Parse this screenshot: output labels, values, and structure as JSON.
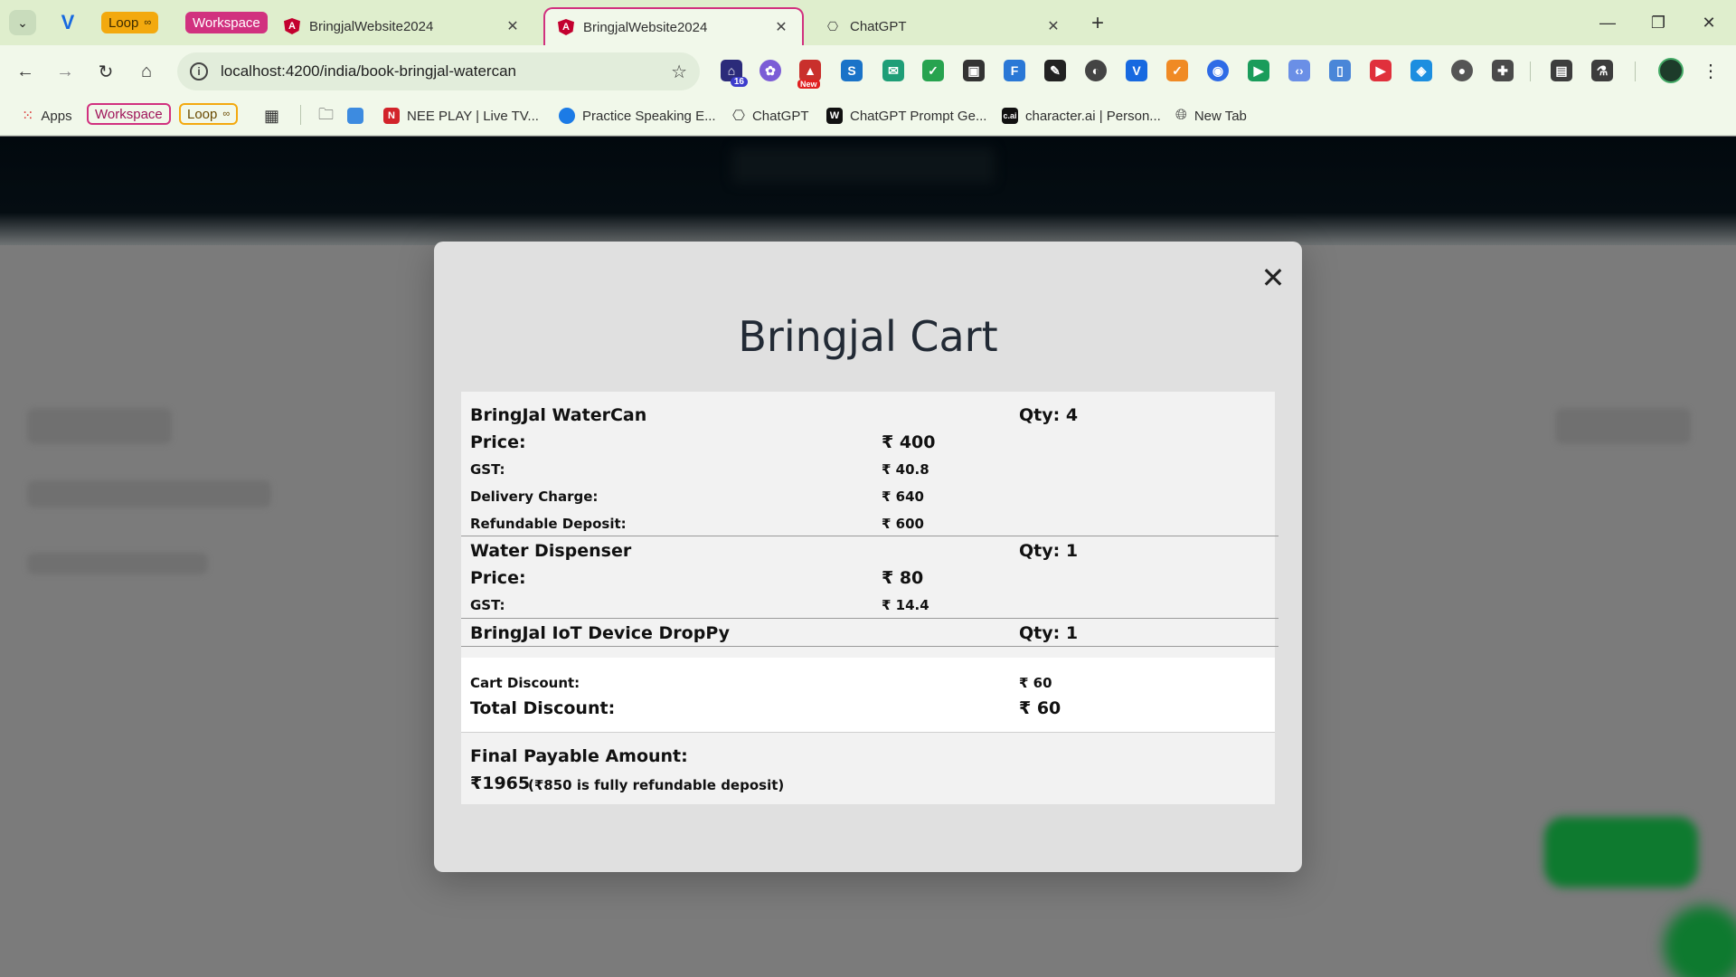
{
  "browser": {
    "tab_groups": {
      "loop": "Loop",
      "workspace": "Workspace"
    },
    "tabs": [
      {
        "title": "BringjalWebsite2024",
        "active": false
      },
      {
        "title": "BringjalWebsite2024",
        "active": true
      },
      {
        "title": "ChatGPT",
        "active": false
      }
    ],
    "url": "localhost:4200/india/book-bringjal-watercan",
    "extension_badges": {
      "count": "16",
      "new_label": "New"
    },
    "bookmarks": {
      "apps": "Apps",
      "workspace": "Workspace",
      "loop": "Loop",
      "items": [
        "NEE PLAY | Live TV...",
        "Practice Speaking E...",
        "ChatGPT",
        "ChatGPT Prompt Ge...",
        "character.ai | Person...",
        "New Tab"
      ]
    }
  },
  "cart": {
    "title": "Bringjal Cart",
    "items": [
      {
        "name": "BringJal WaterCan",
        "qty": "Qty: 4",
        "price_label": "Price:",
        "price": "₹ 400",
        "gst_label": "GST:",
        "gst": "₹ 40.8",
        "delivery_label": "Delivery Charge:",
        "delivery": "₹ 640",
        "deposit_label": "Refundable Deposit:",
        "deposit": "₹ 600"
      },
      {
        "name": "Water Dispenser",
        "qty": "Qty: 1",
        "price_label": "Price:",
        "price": "₹ 80",
        "gst_label": "GST:",
        "gst": "₹ 14.4"
      },
      {
        "name": "BringJal IoT Device DropPy",
        "qty": "Qty: 1"
      }
    ],
    "discount": {
      "cart_label": "Cart Discount:",
      "cart_value": "₹ 60",
      "total_label": "Total Discount:",
      "total_value": "₹ 60"
    },
    "final": {
      "label": "Final Payable Amount:",
      "amount": "₹1965",
      "note": "(₹850 is fully refundable deposit)"
    }
  },
  "colors": {
    "accent_pink": "#d1317f",
    "loop_orange": "#f3a90e",
    "overlay_gray": "#7b7b7b",
    "modal_bg": "#e0e0e0"
  }
}
